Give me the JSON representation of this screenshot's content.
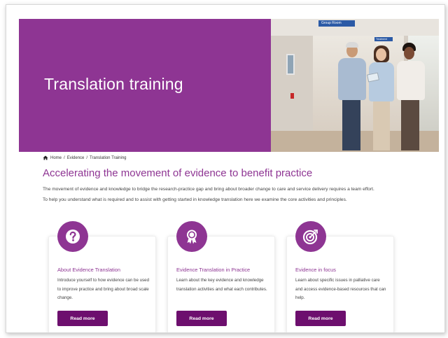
{
  "hero": {
    "title": "Translation training",
    "photo_sign": "Group Room",
    "photo_sign_small": "Treatment Room 2"
  },
  "breadcrumb": {
    "home": "Home",
    "separator": "/",
    "items": [
      "Evidence",
      "Translation Training"
    ]
  },
  "main": {
    "heading": "Accelerating the movement of evidence to benefit practice",
    "intro_line_1": "The movement of evidence and knowledge to bridge the research-practice gap and bring about broader change to care and service delivery requires a team effort.",
    "intro_line_2": "To help you understand what is required and to assist with getting started in knowledge translation here we examine the core activities and principles."
  },
  "cards": [
    {
      "icon": "question-icon",
      "title": "About Evidence Translation",
      "text": "Introduce yourself to how evidence can be used to improve practice and bring about broad scale change.",
      "button": "Read more"
    },
    {
      "icon": "award-ribbon-icon",
      "title": "Evidence Translation in Practice",
      "text": "Learn about the key evidence and knowledge translation activities and what each contributes.",
      "button": "Read more"
    },
    {
      "icon": "target-focus-icon",
      "title": "Evidence in focus",
      "text": "Learn about specific issues in palliative care and access evidence-based resources that can help.",
      "button": "Read more"
    }
  ],
  "colors": {
    "brand_purple": "#8e3593",
    "button_purple": "#6d0f6e",
    "text": "#444444"
  }
}
